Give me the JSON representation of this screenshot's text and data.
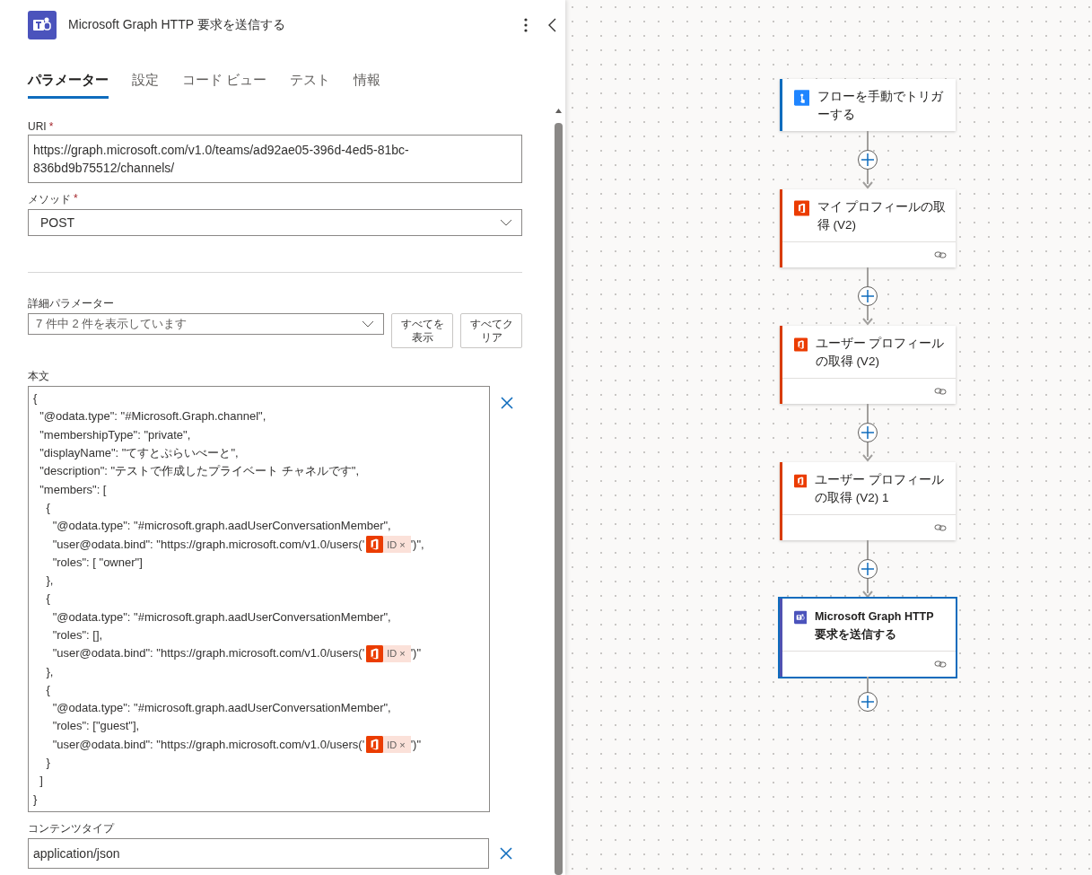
{
  "panel": {
    "title": "Microsoft Graph HTTP 要求を送信する",
    "tabs": [
      {
        "label": "パラメーター",
        "selected": true
      },
      {
        "label": "設定",
        "selected": false
      },
      {
        "label": "コード ビュー",
        "selected": false
      },
      {
        "label": "テスト",
        "selected": false
      },
      {
        "label": "情報",
        "selected": false
      }
    ],
    "uri": {
      "label": "URI",
      "required_mark": "*",
      "value": "https://graph.microsoft.com/v1.0/teams/ad92ae05-396d-4ed5-81bc-836bd9b75512/channels/"
    },
    "method": {
      "label": "メソッド",
      "required_mark": "*",
      "value": "POST"
    },
    "advanced": {
      "label": "詳細パラメーター",
      "value": "7 件中 2 件を表示しています",
      "buttons": [
        "すべてを表示",
        "すべてクリア"
      ]
    },
    "body": {
      "label": "本文",
      "lines": [
        [
          {
            "kind": "text",
            "text": "{"
          }
        ],
        [
          {
            "kind": "text",
            "text": "  \"@odata.type\": \"#Microsoft.Graph.channel\","
          }
        ],
        [
          {
            "kind": "text",
            "text": "  \"membershipType\": \"private\","
          }
        ],
        [
          {
            "kind": "text",
            "text": "  \"displayName\": \"てすとぷらいべーと\","
          }
        ],
        [
          {
            "kind": "text",
            "text": "  \"description\": \"テストで作成したプライベート チャネルです\","
          }
        ],
        [
          {
            "kind": "text",
            "text": "  \"members\": ["
          }
        ],
        [
          {
            "kind": "text",
            "text": "    {"
          }
        ],
        [
          {
            "kind": "text",
            "text": "      \"@odata.type\": \"#microsoft.graph.aadUserConversationMember\","
          }
        ],
        [
          {
            "kind": "text",
            "text": "      \"user@odata.bind\": \"https://graph.microsoft.com/v1.0/users('"
          },
          {
            "kind": "token",
            "label": "ID",
            "remove": "×"
          },
          {
            "kind": "text",
            "text": "')\","
          }
        ],
        [
          {
            "kind": "text",
            "text": "      \"roles\": [ \"owner\"]"
          }
        ],
        [
          {
            "kind": "text",
            "text": "    },"
          }
        ],
        [
          {
            "kind": "text",
            "text": "    {"
          }
        ],
        [
          {
            "kind": "text",
            "text": "      \"@odata.type\": \"#microsoft.graph.aadUserConversationMember\","
          }
        ],
        [
          {
            "kind": "text",
            "text": "      \"roles\": [],"
          }
        ],
        [
          {
            "kind": "text",
            "text": "      \"user@odata.bind\": \"https://graph.microsoft.com/v1.0/users('"
          },
          {
            "kind": "token",
            "label": "ID",
            "remove": "×"
          },
          {
            "kind": "text",
            "text": "')\""
          }
        ],
        [
          {
            "kind": "text",
            "text": "    },"
          }
        ],
        [
          {
            "kind": "text",
            "text": "    {"
          }
        ],
        [
          {
            "kind": "text",
            "text": "      \"@odata.type\": \"#microsoft.graph.aadUserConversationMember\","
          }
        ],
        [
          {
            "kind": "text",
            "text": "      \"roles\": [\"guest\"],"
          }
        ],
        [
          {
            "kind": "text",
            "text": "      \"user@odata.bind\": \"https://graph.microsoft.com/v1.0/users('"
          },
          {
            "kind": "token",
            "label": "ID",
            "remove": "×"
          },
          {
            "kind": "text",
            "text": "')\""
          }
        ],
        [
          {
            "kind": "text",
            "text": "    }"
          }
        ],
        [
          {
            "kind": "text",
            "text": "  ]"
          }
        ],
        [
          {
            "kind": "text",
            "text": "}"
          }
        ]
      ]
    },
    "content_type": {
      "label": "コンテンツタイプ",
      "value": "application/json"
    }
  },
  "flow": [
    {
      "kind": "trigger",
      "title": "フローを手動でトリガーする",
      "selected": false
    },
    {
      "kind": "office",
      "title": "マイ プロフィールの取得 (V2)",
      "selected": false
    },
    {
      "kind": "office",
      "title": "ユーザー プロフィールの取得 (V2)",
      "selected": false
    },
    {
      "kind": "office",
      "title": "ユーザー プロフィールの取得 (V2) 1",
      "selected": false
    },
    {
      "kind": "teams",
      "title": "Microsoft Graph HTTP 要求を送信する",
      "selected": true
    }
  ]
}
